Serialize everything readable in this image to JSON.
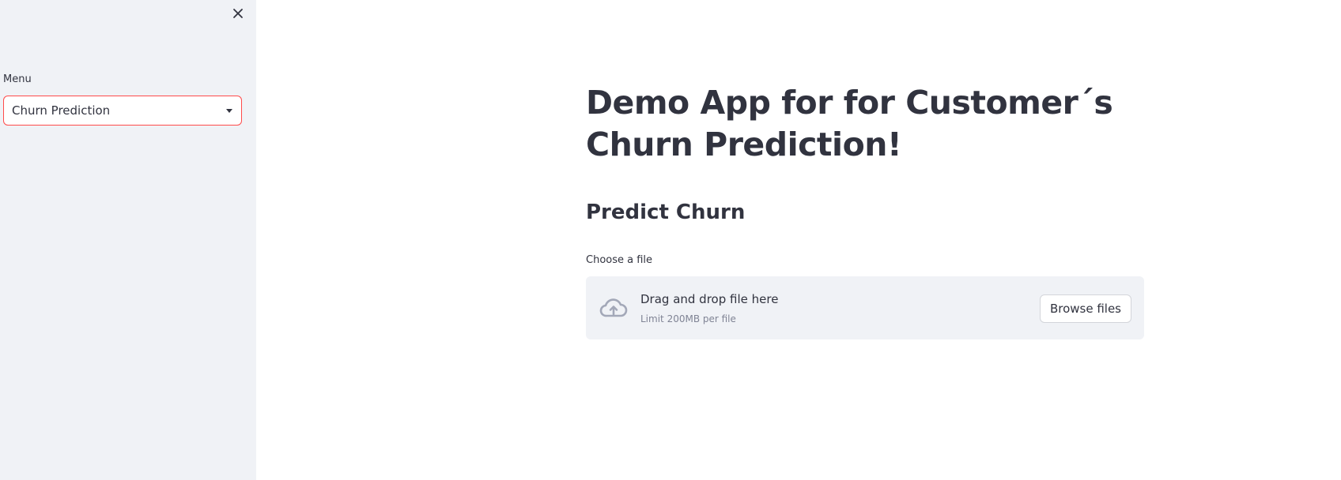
{
  "sidebar": {
    "close_icon": "close-icon",
    "menu_label": "Menu",
    "menu_select": {
      "selected": "Churn Prediction",
      "icon": "chevron-down-icon"
    },
    "accent_color": "#ff4b4b",
    "background": "#f0f2f6"
  },
  "main": {
    "title": "Demo App for for Customer´s Churn Prediction!",
    "subtitle": "Predict Churn",
    "uploader": {
      "label": "Choose a file",
      "drop_text": "Drag and drop file here",
      "limit_text": "Limit 200MB per file",
      "browse_label": "Browse files",
      "icon": "cloud-upload-icon"
    }
  }
}
